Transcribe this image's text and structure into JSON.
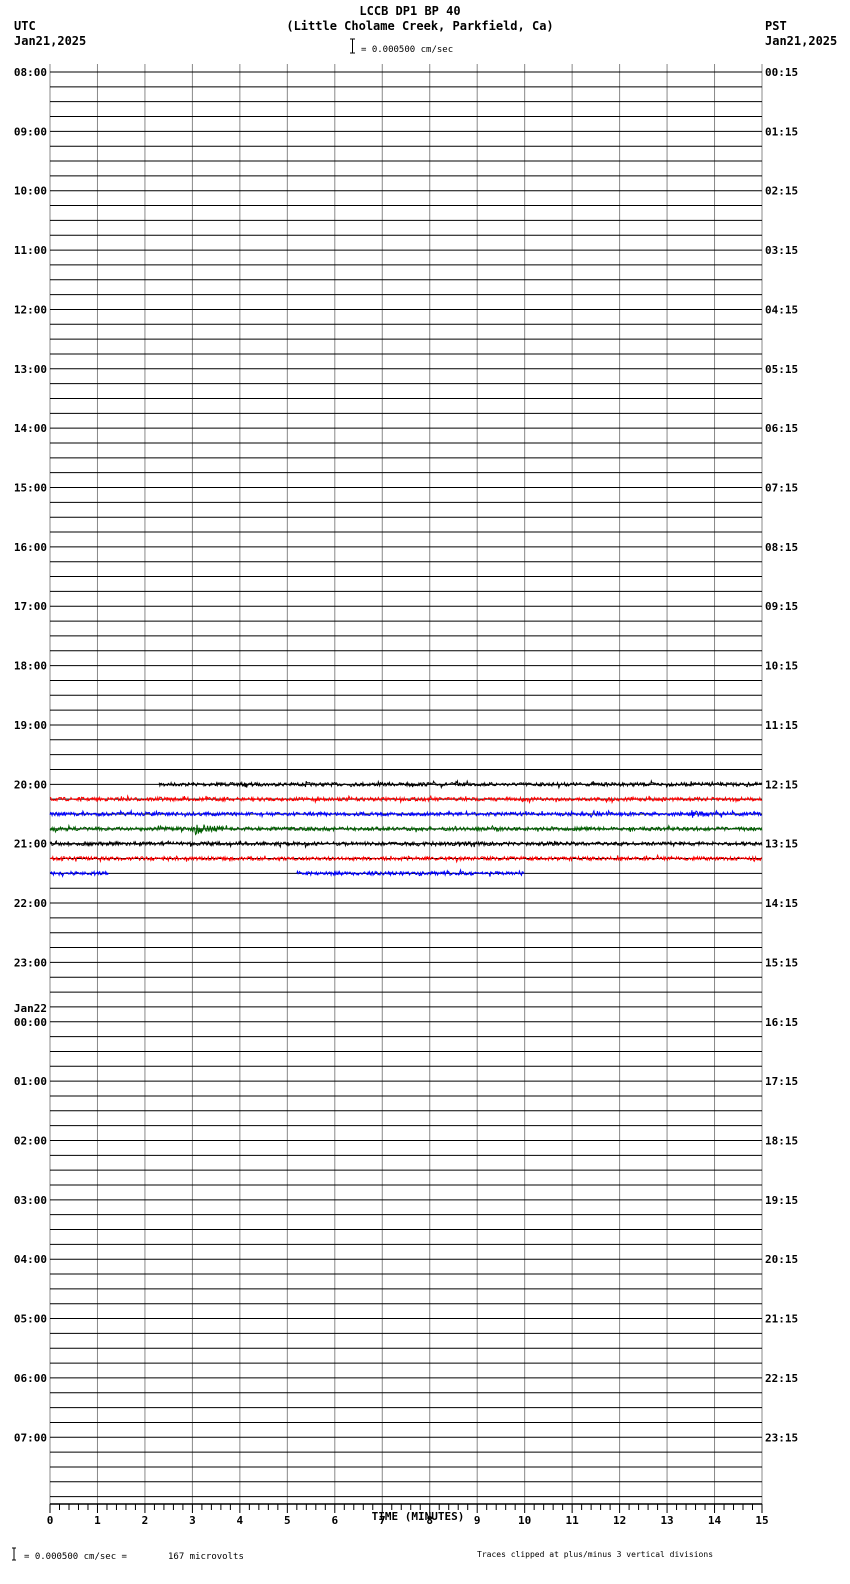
{
  "chart_data": {
    "type": "line",
    "title": "LCCB DP1 BP 40",
    "subtitle": "(Little Cholame Creek, Parkfield, Ca)",
    "left_tz": "UTC",
    "left_date": "Jan21,2025",
    "right_tz": "PST",
    "right_date": "Jan21,2025",
    "scale_label": "= 0.000500 cm/sec",
    "xlabel": "TIME (MINUTES)",
    "xlim": [
      0,
      15
    ],
    "x_ticks": [
      "0",
      "1",
      "2",
      "3",
      "4",
      "5",
      "6",
      "7",
      "8",
      "9",
      "10",
      "11",
      "12",
      "13",
      "14",
      "15"
    ],
    "lines_per_hour": 4,
    "left_labels": [
      "08:00",
      "09:00",
      "10:00",
      "11:00",
      "12:00",
      "13:00",
      "14:00",
      "15:00",
      "16:00",
      "17:00",
      "18:00",
      "19:00",
      "20:00",
      "21:00",
      "22:00",
      "23:00",
      "00:00",
      "01:00",
      "02:00",
      "03:00",
      "04:00",
      "05:00",
      "06:00",
      "07:00"
    ],
    "date_change_label": "Jan22",
    "right_labels": [
      "00:15",
      "01:15",
      "02:15",
      "03:15",
      "04:15",
      "05:15",
      "06:15",
      "07:15",
      "08:15",
      "09:15",
      "10:15",
      "11:15",
      "12:15",
      "13:15",
      "14:15",
      "15:15",
      "16:15",
      "17:15",
      "18:15",
      "19:15",
      "20:15",
      "21:15",
      "22:15",
      "23:15"
    ],
    "traces": [
      {
        "line": 48,
        "color": "#000000",
        "segments": [
          [
            2.3,
            15
          ]
        ]
      },
      {
        "line": 49,
        "color": "#ff0000",
        "segments": [
          [
            0,
            15
          ]
        ]
      },
      {
        "line": 50,
        "color": "#0000ff",
        "segments": [
          [
            0,
            15
          ]
        ],
        "event_min": 13.5
      },
      {
        "line": 51,
        "color": "#006000",
        "segments": [
          [
            0,
            15
          ]
        ],
        "event_min": 3.0
      },
      {
        "line": 52,
        "color": "#000000",
        "segments": [
          [
            0,
            15
          ]
        ]
      },
      {
        "line": 53,
        "color": "#ff0000",
        "segments": [
          [
            0,
            15
          ]
        ]
      },
      {
        "line": 54,
        "color": "#0000ff",
        "segments": [
          [
            0,
            1.25
          ],
          [
            5.2,
            10.0
          ]
        ]
      }
    ]
  },
  "footer": {
    "scale": "= 0.000500 cm/sec =",
    "microvolts": "167 microvolts",
    "clip_note": "Traces clipped at plus/minus 3 vertical divisions"
  }
}
